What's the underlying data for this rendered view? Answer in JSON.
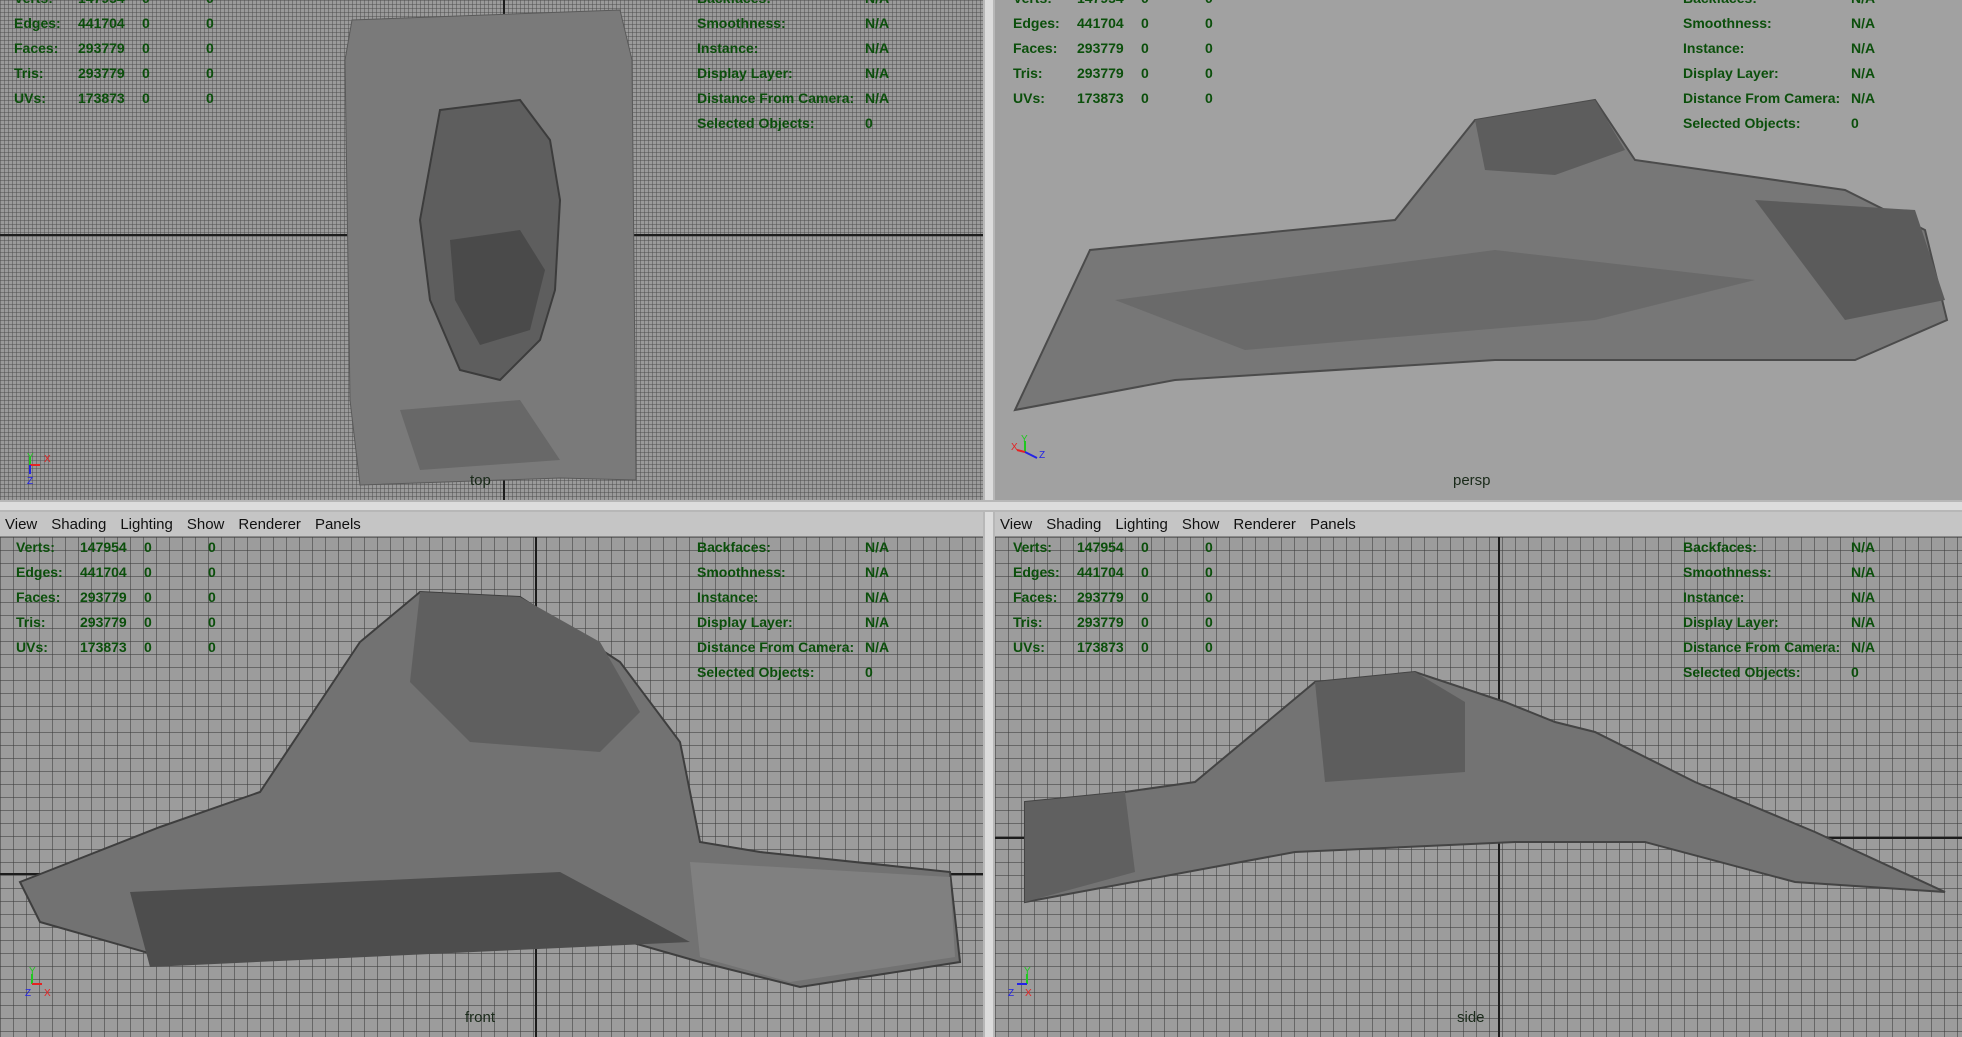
{
  "menu": [
    "View",
    "Shading",
    "Lighting",
    "Show",
    "Renderer",
    "Panels"
  ],
  "stats": [
    {
      "label": "Verts:",
      "a": "147954",
      "b": "0",
      "c": "0"
    },
    {
      "label": "Edges:",
      "a": "441704",
      "b": "0",
      "c": "0"
    },
    {
      "label": "Faces:",
      "a": "293779",
      "b": "0",
      "c": "0"
    },
    {
      "label": "Tris:",
      "a": "293779",
      "b": "0",
      "c": "0"
    },
    {
      "label": "UVs:",
      "a": "173873",
      "b": "0",
      "c": "0"
    }
  ],
  "info": [
    {
      "label": "Backfaces:",
      "value": "N/A"
    },
    {
      "label": "Smoothness:",
      "value": "N/A"
    },
    {
      "label": "Instance:",
      "value": "N/A"
    },
    {
      "label": "Display Layer:",
      "value": "N/A"
    },
    {
      "label": "Distance From Camera:",
      "value": "N/A"
    },
    {
      "label": "Selected Objects:",
      "value": "0"
    }
  ],
  "viewports": {
    "top": {
      "name": "top"
    },
    "persp": {
      "name": "persp"
    },
    "front": {
      "name": "front"
    },
    "side": {
      "name": "side"
    }
  },
  "axes": {
    "top": [
      "Y",
      "X",
      "Z"
    ],
    "persp": [
      "Y",
      "X",
      "Z"
    ],
    "front": [
      "Y",
      "Z",
      "X"
    ],
    "side": [
      "Y",
      "Z",
      "X"
    ]
  },
  "colors": {
    "hud": "#0b4f0b",
    "x_axis": "#e52222",
    "y_axis": "#1fc81f",
    "z_axis": "#2323e6",
    "mesh": "#6e6e6e"
  }
}
